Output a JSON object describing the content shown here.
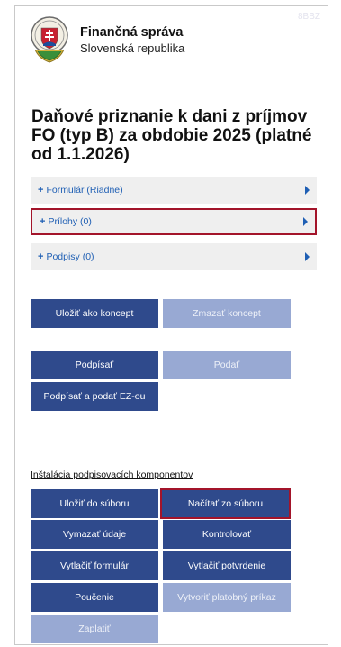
{
  "corner_code": "8BBZ",
  "header": {
    "title": "Finančná správa",
    "subtitle": "Slovenská republika",
    "logo_icon": "coat-of-arms-icon"
  },
  "page_title": "Daňové priznanie k dani z príjmov FO (typ B) za obdobie 2025 (platné od 1.1.2026)",
  "sections": [
    {
      "plus": "+",
      "label": "Formulár (Riadne)",
      "highlighted": false
    },
    {
      "plus": "+",
      "label": "Prílohy (0)",
      "highlighted": true
    },
    {
      "plus": "+",
      "label": "Podpisy (0)",
      "highlighted": false
    }
  ],
  "buttons": {
    "save_draft": "Uložiť ako koncept",
    "delete_draft": "Zmazať koncept",
    "sign": "Podpísať",
    "submit": "Podať",
    "sign_submit_ez": "Podpísať a podať EZ-ou",
    "save_file": "Uložiť do súboru",
    "load_file": "Načítať zo súboru",
    "clear_data": "Vymazať údaje",
    "check": "Kontrolovať",
    "print_form": "Vytlačiť formulár",
    "print_confirmation": "Vytlačiť potvrdenie",
    "instructions": "Poučenie",
    "create_payment": "Vytvoriť platobný príkaz",
    "pay": "Zaplatiť"
  },
  "install_link": "Inštalácia podpisovacích komponentov",
  "colors": {
    "primary": "#2f4a8c",
    "disabled": "#98a9d3",
    "highlight": "#a3142a",
    "link": "#1f5fb4"
  }
}
